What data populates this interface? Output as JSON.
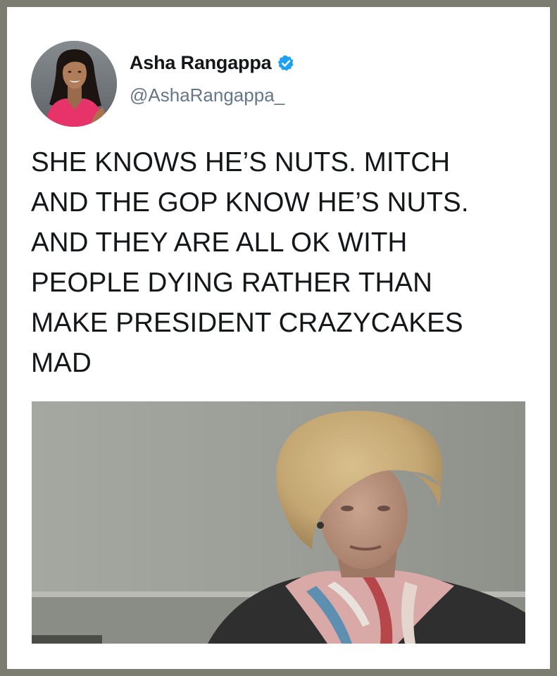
{
  "tweet": {
    "author": {
      "name": "Asha Rangappa",
      "handle": "@AshaRangappa_",
      "verified": true,
      "verified_icon": "verified-badge-icon"
    },
    "text_lines": [
      "SHE KNOWS HE’S NUTS. MITCH",
      "AND THE GOP KNOW HE’S NUTS.",
      "AND THEY ARE ALL OK WITH",
      "PEOPLE DYING RATHER THAN",
      "MAKE PRESIDENT CRAZYCAKES",
      "MAD"
    ]
  },
  "colors": {
    "border": "#7c7d70",
    "card_background": "#ffffff",
    "text": "#14171a",
    "handle": "#657786",
    "verified_blue": "#1da1f2"
  }
}
